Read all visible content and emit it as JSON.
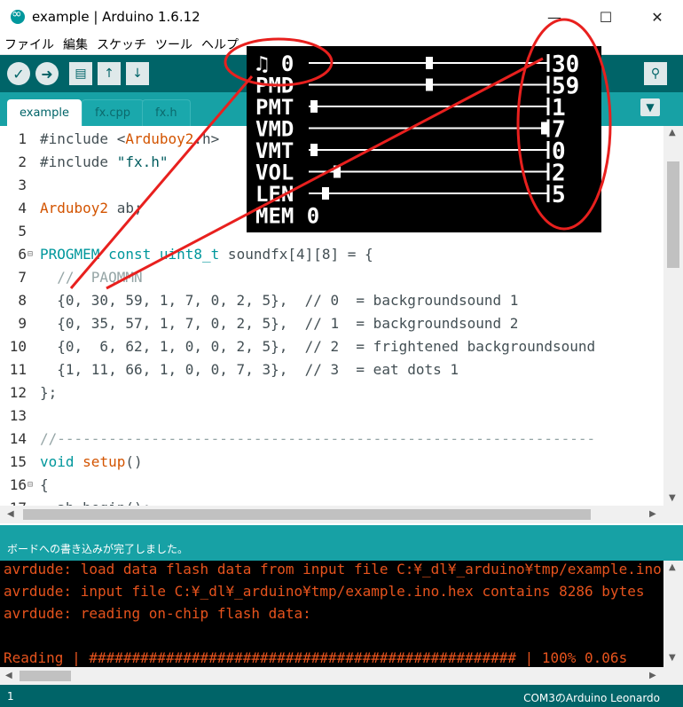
{
  "window": {
    "title": "example | Arduino 1.6.12",
    "minimize": "—",
    "maximize": "☐",
    "close": "✕"
  },
  "menu": [
    "ファイル",
    "編集",
    "スケッチ",
    "ツール",
    "ヘルプ"
  ],
  "toolbar": {
    "verify_icon": "✓",
    "upload_icon": "➜",
    "new_icon": "▤",
    "open_icon": "↑",
    "save_icon": "↓",
    "serial_monitor_icon": "⚲"
  },
  "tabs": [
    {
      "label": "example",
      "active": true
    },
    {
      "label": "fx.cpp",
      "active": false
    },
    {
      "label": "fx.h",
      "active": false
    }
  ],
  "tab_menu_icon": "▼",
  "editor": {
    "lines": [
      {
        "n": "1",
        "segments": [
          {
            "t": "#include <",
            "c": ""
          },
          {
            "t": "Arduboy2",
            "c": "ty"
          },
          {
            "t": ".h>",
            "c": ""
          }
        ]
      },
      {
        "n": "2",
        "segments": [
          {
            "t": "#include ",
            "c": ""
          },
          {
            "t": "\"fx.h\"",
            "c": "str"
          }
        ]
      },
      {
        "n": "3",
        "segments": []
      },
      {
        "n": "4",
        "segments": [
          {
            "t": "Arduboy2",
            "c": "ty"
          },
          {
            "t": " ab;",
            "c": ""
          }
        ]
      },
      {
        "n": "5",
        "segments": []
      },
      {
        "n": "6",
        "fold": "⊟",
        "segments": [
          {
            "t": "PROGMEM const uint8_t",
            "c": "kw"
          },
          {
            "t": " soundfx[4][8] = {",
            "c": ""
          }
        ]
      },
      {
        "n": "7",
        "segments": [
          {
            "t": "  //  PAQMMN",
            "c": "cm"
          }
        ]
      },
      {
        "n": "8",
        "segments": [
          {
            "t": "  {0, 30, 59, 1, 7, 0, 2, 5},  // 0  = backgroundsound 1",
            "c": ""
          }
        ]
      },
      {
        "n": "9",
        "segments": [
          {
            "t": "  {0, 35, 57, 1, 7, 0, 2, 5},  // 1  = backgroundsound 2",
            "c": ""
          }
        ]
      },
      {
        "n": "10",
        "segments": [
          {
            "t": "  {0,  6, 62, 1, 0, 0, 2, 5},  // 2  = frightened backgroundsound",
            "c": ""
          }
        ]
      },
      {
        "n": "11",
        "segments": [
          {
            "t": "  {1, 11, 66, 1, 0, 0, 7, 3},  // 3  = eat dots 1",
            "c": ""
          }
        ]
      },
      {
        "n": "12",
        "segments": [
          {
            "t": "};",
            "c": ""
          }
        ]
      },
      {
        "n": "13",
        "segments": []
      },
      {
        "n": "14",
        "segments": [
          {
            "t": "//---------------------------------------------------------------",
            "c": "cm"
          }
        ]
      },
      {
        "n": "15",
        "segments": [
          {
            "t": "void",
            "c": "kw"
          },
          {
            "t": " ",
            "c": ""
          },
          {
            "t": "setup",
            "c": "ty"
          },
          {
            "t": "()",
            "c": ""
          }
        ]
      },
      {
        "n": "16",
        "fold": "⊟",
        "segments": [
          {
            "t": "{",
            "c": ""
          }
        ]
      },
      {
        "n": "17",
        "segments": [
          {
            "t": "  ab.begin();",
            "c": ""
          }
        ]
      }
    ]
  },
  "oled": {
    "rows": [
      {
        "label": "♫ 0",
        "value": "30",
        "slider": 0.5
      },
      {
        "label": "PMD",
        "value": "59",
        "slider": 0.5
      },
      {
        "label": "PMT",
        "value": "1",
        "slider": 0.0
      },
      {
        "label": "VMD",
        "value": "7",
        "slider": 1.0
      },
      {
        "label": "VMT",
        "value": "0",
        "slider": 0.0
      },
      {
        "label": "VOL",
        "value": "2",
        "slider": 0.1
      },
      {
        "label": "LEN",
        "value": "5",
        "slider": 0.05
      },
      {
        "label": "MEM 0",
        "value": "",
        "slider": null
      }
    ]
  },
  "status_message": "ボードへの書き込みが完了しました。",
  "console": [
    "avrdude: load data flash data from input file C:¥_dl¥_arduino¥tmp/example.ino.hex:",
    "avrdude: input file C:¥_dl¥_arduino¥tmp/example.ino.hex contains 8286 bytes",
    "avrdude: reading on-chip flash data:",
    "",
    "Reading | ################################################## | 100% 0.06s"
  ],
  "footer": {
    "line": "1",
    "board": "COM3のArduino Leonardo"
  },
  "colors": {
    "teal_dark": "#006468",
    "teal": "#17a1a5",
    "annotation": "#e8201e",
    "console_text": "#e6531d"
  }
}
